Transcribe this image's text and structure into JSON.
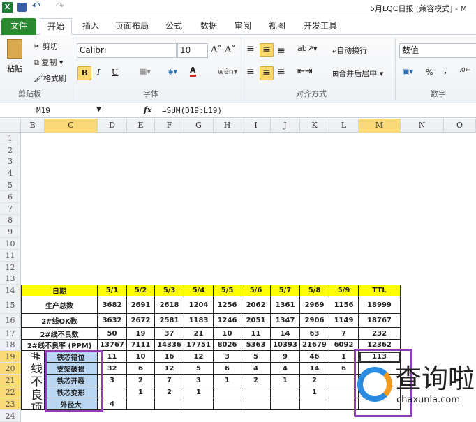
{
  "titlebar": {
    "title": "5月LQC日报  [兼容模式] - M",
    "undo": "↶",
    "redo": "↷"
  },
  "tabs": [
    "文件",
    "开始",
    "插入",
    "页面布局",
    "公式",
    "数据",
    "审阅",
    "视图",
    "开发工具"
  ],
  "ribbon": {
    "clipboard": {
      "paste": "粘贴",
      "cut": "剪切",
      "copy": "复制",
      "format_painter": "格式刷",
      "group": "剪贴板"
    },
    "font": {
      "name": "Calibri",
      "size": "10",
      "bold": "B",
      "italic": "I",
      "underline": "U",
      "group": "字体"
    },
    "alignment": {
      "wrap": "自动换行",
      "merge": "合并后居中",
      "group": "对齐方式"
    },
    "number": {
      "format": "数值",
      "percent": "%",
      "comma": ",",
      "group": "数字"
    }
  },
  "formula_bar": {
    "name_box": "M19",
    "fx": "fx",
    "formula": "=SUM(D19:L19)"
  },
  "columns": [
    "B",
    "C",
    "D",
    "E",
    "F",
    "G",
    "H",
    "I",
    "J",
    "K",
    "L",
    "M",
    "N",
    "O"
  ],
  "selected_column": "M",
  "rows": [
    "1",
    "2",
    "3",
    "4",
    "5",
    "6",
    "7",
    "8",
    "9",
    "10",
    "11",
    "12",
    "13",
    "14",
    "15",
    "16",
    "17",
    "18",
    "19",
    "20",
    "21",
    "22",
    "23",
    "24"
  ],
  "table": {
    "header": [
      "日期",
      "5/1",
      "5/2",
      "5/3",
      "5/4",
      "5/5",
      "5/6",
      "5/7",
      "5/8",
      "5/9",
      "TTL"
    ],
    "summary": [
      [
        "生产总数",
        "3682",
        "2691",
        "2618",
        "1204",
        "1256",
        "2062",
        "1361",
        "2969",
        "1156",
        "18999"
      ],
      [
        "2#线OK数",
        "3632",
        "2672",
        "2581",
        "1183",
        "1246",
        "2051",
        "1347",
        "2906",
        "1149",
        "18767"
      ],
      [
        "2#线不良数",
        "50",
        "19",
        "37",
        "21",
        "10",
        "11",
        "14",
        "63",
        "7",
        "232"
      ],
      [
        "2#线不良率 (PPM)",
        "13767",
        "7111",
        "14336",
        "17751",
        "8026",
        "5363",
        "10393",
        "21679",
        "6092",
        "12362"
      ]
    ],
    "defect_group_label": "#线不良项",
    "defects": [
      [
        "铁芯错位",
        "11",
        "10",
        "16",
        "12",
        "3",
        "5",
        "9",
        "46",
        "1",
        "113"
      ],
      [
        "支架破损",
        "32",
        "6",
        "12",
        "5",
        "6",
        "4",
        "4",
        "14",
        "6",
        ""
      ],
      [
        "铁芯开裂",
        "3",
        "2",
        "7",
        "3",
        "1",
        "2",
        "1",
        "2",
        "",
        ""
      ],
      [
        "铁芯变形",
        "",
        "1",
        "2",
        "1",
        "",
        "",
        "",
        "1",
        "",
        ""
      ],
      [
        "外径大",
        "4",
        "",
        "",
        "",
        "",
        "",
        "",
        "",
        "",
        ""
      ]
    ]
  },
  "watermark": {
    "text": "查询啦",
    "url": "chaxunla.com"
  },
  "colors": {
    "header_yellow": "#ffff00",
    "defect_blue": "#b9d6f2",
    "highlight_purple": "#8e3fb5",
    "selection": "#f9d978"
  }
}
